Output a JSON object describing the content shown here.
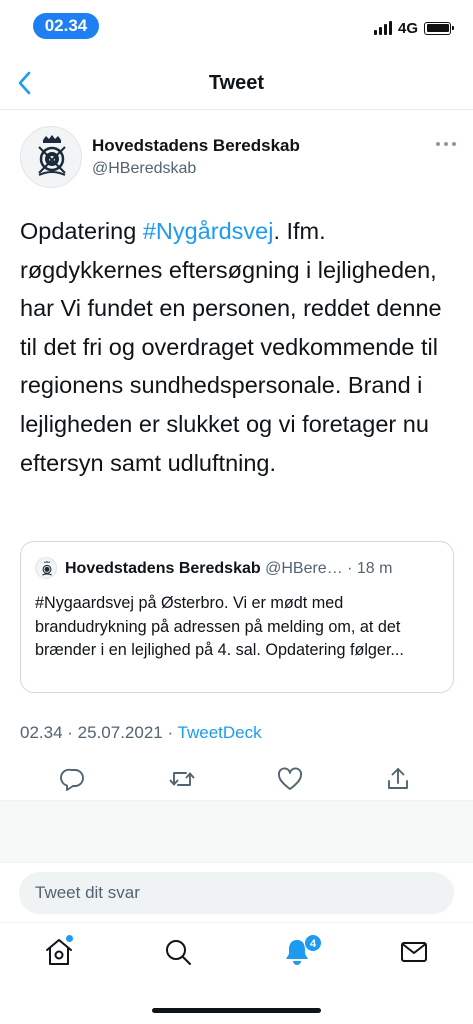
{
  "status_bar": {
    "time": "02.34",
    "network": "4G"
  },
  "header": {
    "title": "Tweet",
    "back_icon": "chevron-left-icon"
  },
  "tweet": {
    "author_name": "Hovedstadens Beredskab",
    "author_handle": "@HBeredskab",
    "text_before_hashtag": "Opdatering ",
    "hashtag": "#Nygårdsvej",
    "text_after_hashtag": ". Ifm. røgdykkernes eftersøgning i lejligheden, har Vi fundet en personen, reddet denne til det fri og overdraget vedkommende til regionens sundhedspersonale. Brand i lejligheden er slukket og vi foretager nu eftersyn samt udluftning.",
    "meta_time": "02.34 · 25.07.2021 · ",
    "meta_source": "TweetDeck"
  },
  "quoted_tweet": {
    "author_name": "Hovedstadens Beredskab",
    "author_handle": "@HBere…",
    "age": " · 18 m",
    "text": "#Nygaardsvej på Østerbro. Vi er mødt med brandudrykning på adressen på melding om, at det brænder i en lejlighed på 4. sal. Opdatering følger..."
  },
  "actions": [
    "reply-icon",
    "retweet-icon",
    "like-icon",
    "share-icon"
  ],
  "reply": {
    "placeholder": "Tweet dit svar"
  },
  "tab_bar": {
    "items": [
      "home-icon",
      "search-icon",
      "notifications-icon",
      "messages-icon"
    ],
    "notification_count": "4"
  },
  "colors": {
    "accent": "#1d9bf0",
    "time_pill": "#1d7ff2",
    "text": "#0f1419",
    "secondary": "#536471"
  }
}
